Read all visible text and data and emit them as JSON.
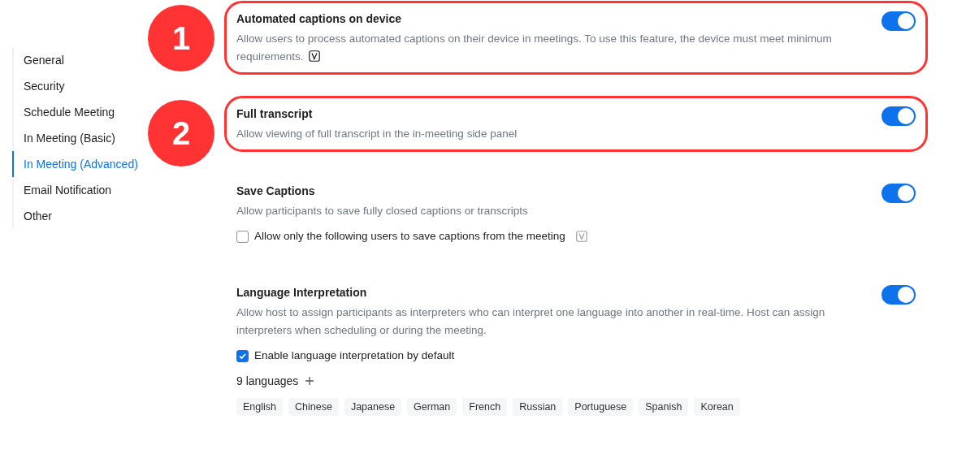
{
  "sidebar": {
    "items": [
      {
        "label": "General",
        "selected": false
      },
      {
        "label": "Security",
        "selected": false
      },
      {
        "label": "Schedule Meeting",
        "selected": false
      },
      {
        "label": "In Meeting (Basic)",
        "selected": false
      },
      {
        "label": "In Meeting (Advanced)",
        "selected": true
      },
      {
        "label": "Email Notification",
        "selected": false
      },
      {
        "label": "Other",
        "selected": false
      }
    ]
  },
  "settings": [
    {
      "title": "Automated captions on device",
      "description": "Allow users to process automated captions on their device in meetings. To use this feature, the device must meet minimum requirements.",
      "version_icon": true,
      "on": true,
      "callout": "1"
    },
    {
      "title": "Full transcript",
      "description": "Allow viewing of full transcript in the in-meeting side panel",
      "on": true,
      "callout": "2"
    },
    {
      "title": "Save Captions",
      "description": "Allow participants to save fully closed captions or transcripts",
      "on": true,
      "options": [
        {
          "label": "Allow only the following users to save captions from the meeting",
          "checked": false,
          "version_icon": true
        }
      ]
    },
    {
      "title": "Language Interpretation",
      "description": "Allow host to assign participants as interpreters who can interpret one language into another in real-time. Host can assign interpreters when scheduling or during the meeting.",
      "on": true,
      "options": [
        {
          "label": "Enable language interpretation by default",
          "checked": true
        }
      ],
      "languages": {
        "label": "9 languages",
        "tags": [
          "English",
          "Chinese",
          "Japanese",
          "German",
          "French",
          "Russian",
          "Portuguese",
          "Spanish",
          "Korean"
        ]
      }
    }
  ]
}
